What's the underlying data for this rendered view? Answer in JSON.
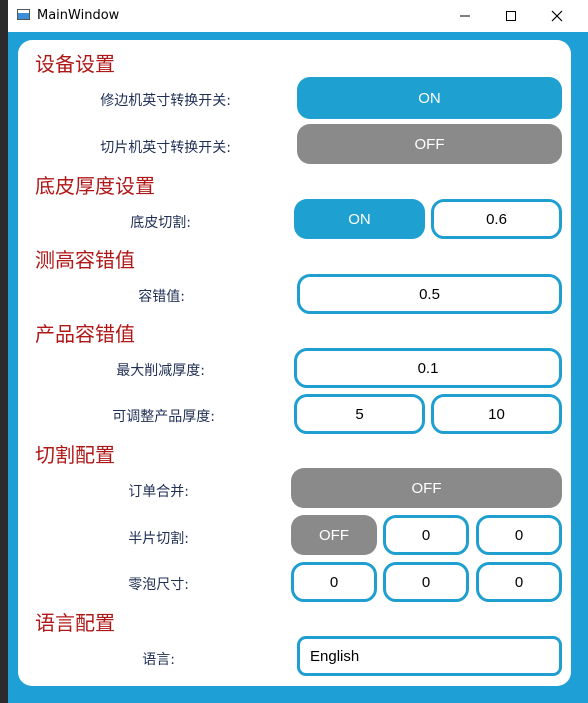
{
  "window": {
    "title": "MainWindow"
  },
  "sections": {
    "device": {
      "title": "设备设置",
      "edge_inch": {
        "label": "修边机英寸转换开关:",
        "value": "ON"
      },
      "slice_inch": {
        "label": "切片机英寸转换开关:",
        "value": "OFF"
      }
    },
    "bottom": {
      "title": "底皮厚度设置",
      "cut": {
        "label": "底皮切割:",
        "toggle": "ON",
        "value": "0.6"
      }
    },
    "height": {
      "title": "测高容错值",
      "tolerance": {
        "label": "容错值:",
        "value": "0.5"
      }
    },
    "product": {
      "title": "产品容错值",
      "max_reduce": {
        "label": "最大削减厚度:",
        "value": "0.1"
      },
      "adjustable": {
        "label": "可调整产品厚度:",
        "min": "5",
        "max": "10"
      }
    },
    "cutting": {
      "title": "切割配置",
      "merge": {
        "label": "订单合并:",
        "value": "OFF"
      },
      "half": {
        "label": "半片切割:",
        "toggle": "OFF",
        "a": "0",
        "b": "0"
      },
      "bubble": {
        "label": "零泡尺寸:",
        "a": "0",
        "b": "0",
        "c": "0"
      }
    },
    "language": {
      "title": "语言配置",
      "lang": {
        "label": "语言:",
        "value": "English"
      }
    }
  },
  "colors": {
    "frame": "#1ea0d6",
    "on": "#1ea0d0",
    "off": "#8a8a8a",
    "section_title": "#b01818",
    "label": "#1f2f55"
  }
}
